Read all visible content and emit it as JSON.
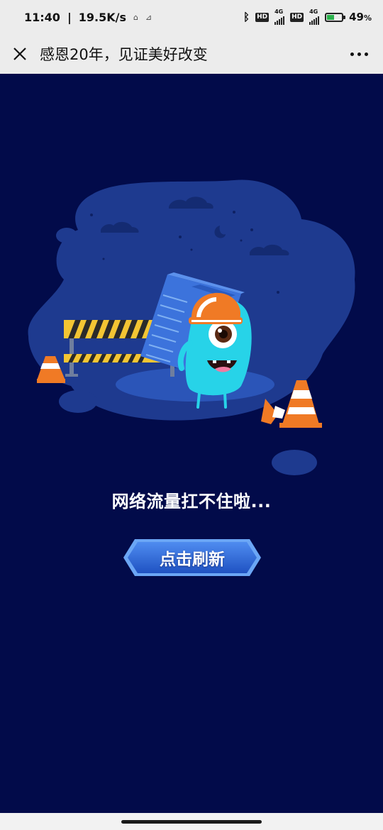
{
  "status_bar": {
    "time": "11:40",
    "speed": "19.5K/s",
    "network1": "4G",
    "network2": "4G",
    "hd1": "HD",
    "hd2": "HD",
    "battery_percent": "49",
    "battery_level": 0.49,
    "percent_sign": "%"
  },
  "navbar": {
    "title": "感恩20年，见证美好改变",
    "close_icon": "close-icon",
    "more_icon": "more-icon"
  },
  "main": {
    "message": "网络流量扛不住啦...",
    "refresh_label": "点击刷新"
  },
  "colors": {
    "background": "#020b4a",
    "blob": "#1e3a8f",
    "monster": "#27d3e8",
    "hardhat": "#f07a25",
    "button": "#2c6ad6"
  }
}
